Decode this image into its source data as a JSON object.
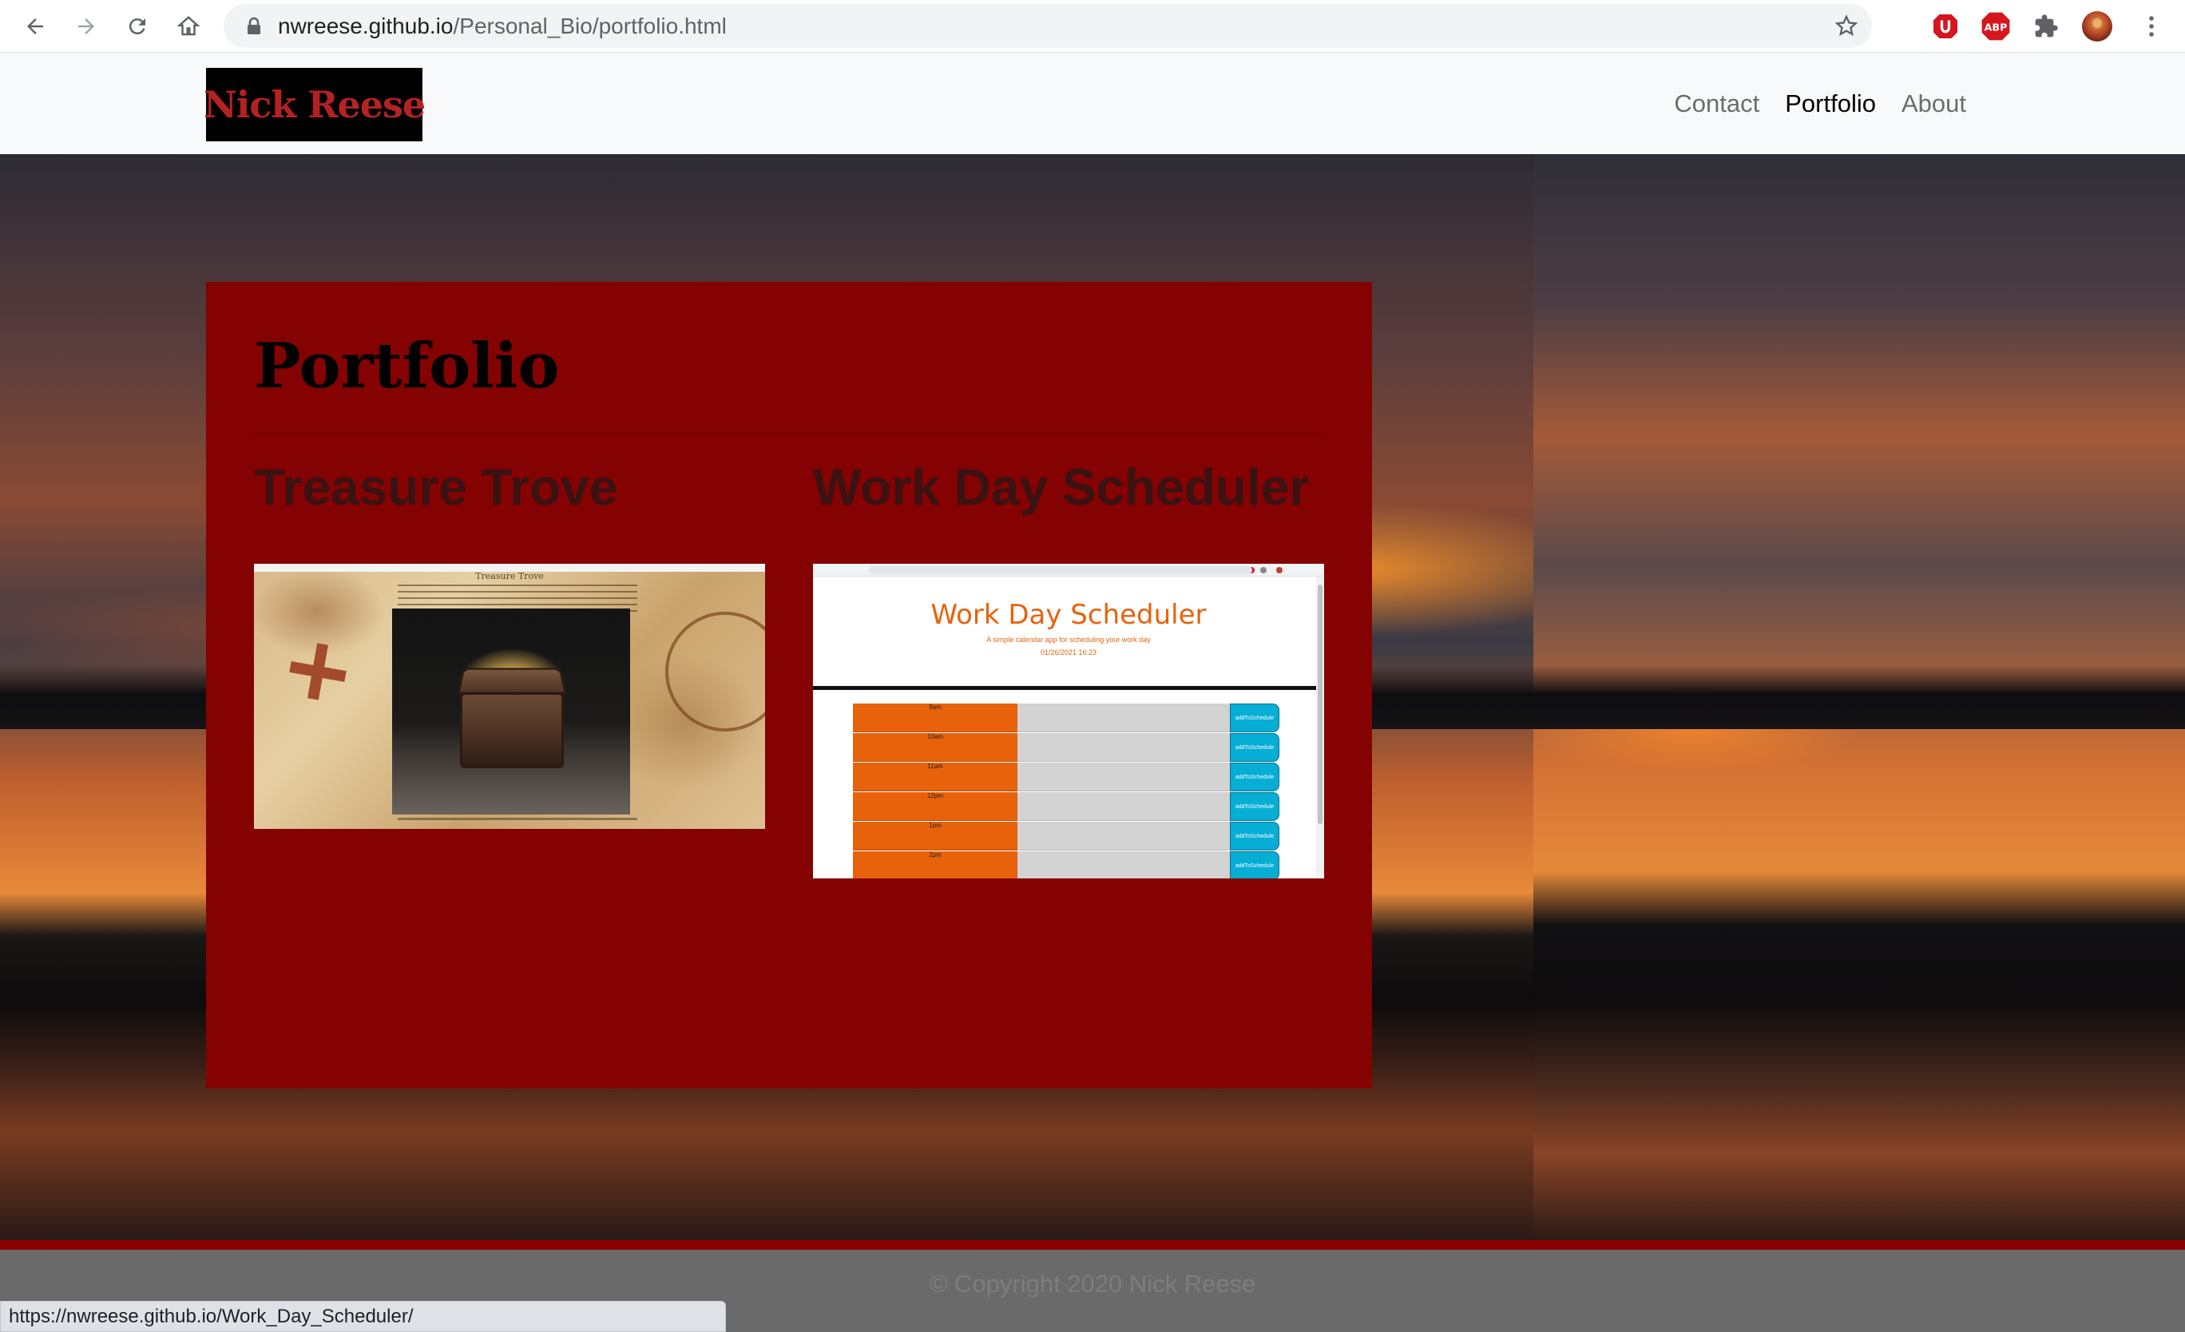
{
  "browser": {
    "url_host": "nwreese.github.io",
    "url_path": "/Personal_Bio/portfolio.html",
    "status_url": "https://nwreese.github.io/Work_Day_Scheduler/"
  },
  "site": {
    "brand": "Nick Reese",
    "nav": [
      "Contact",
      "Portfolio",
      "About"
    ],
    "active_nav": "Portfolio"
  },
  "portfolio": {
    "title": "Portfolio",
    "projects": [
      {
        "title": "Treasure Trove",
        "thumbnail": {
          "heading": "Treasure Trove"
        }
      },
      {
        "title": "Work Day Scheduler",
        "thumbnail": {
          "heading": "Work Day Scheduler",
          "subtitle": "A simple calendar app for scheduling your work day",
          "date": "01/26/2021 16:23",
          "hours": [
            "9am",
            "10am",
            "11am",
            "12pm",
            "1pm",
            "2pm"
          ],
          "button_label": "addToSchedule"
        }
      }
    ]
  },
  "footer": {
    "text": "© Copyright 2020 Nick Reese"
  },
  "colors": {
    "card": "#840202",
    "brand_text": "#b22222",
    "scheduler_accent": "#e8620c",
    "scheduler_button": "#06aed5",
    "footer_strip": "#8b0000"
  }
}
